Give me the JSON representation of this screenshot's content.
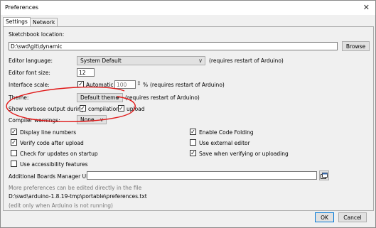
{
  "window": {
    "title": "Preferences",
    "close_glyph": "✕"
  },
  "tabs": [
    {
      "label": "Settings"
    },
    {
      "label": "Network"
    }
  ],
  "sketchbook": {
    "label": "Sketchbook location:",
    "value": "D:\\swd\\git\\dynamic",
    "browse_label": "Browse"
  },
  "editor_language": {
    "label": "Editor language:",
    "value": "System Default",
    "note": "(requires restart of Arduino)"
  },
  "editor_font": {
    "label": "Editor font size:",
    "value": "12"
  },
  "interface_scale": {
    "label": "Interface scale:",
    "automatic_label": "Automatic",
    "value": "100",
    "percent": "%",
    "note": "(requires restart of Arduino)"
  },
  "theme": {
    "label": "Theme:",
    "value": "Default theme",
    "note": "(requires restart of Arduino)"
  },
  "verbose": {
    "label": "Show verbose output during:",
    "compilation_label": "compilation",
    "upload_label": "upload"
  },
  "compiler_warnings": {
    "label": "Compiler warnings:",
    "value": "None"
  },
  "options_left": [
    {
      "label": "Display line numbers",
      "checked": true
    },
    {
      "label": "Verify code after upload",
      "checked": true
    },
    {
      "label": "Check for updates on startup",
      "checked": false
    },
    {
      "label": "Use accessibility features",
      "checked": false
    }
  ],
  "options_right": [
    {
      "label": "Enable Code Folding",
      "checked": true
    },
    {
      "label": "Use external editor",
      "checked": false
    },
    {
      "label": "Save when verifying or uploading",
      "checked": true
    }
  ],
  "boards_manager": {
    "label": "Additional Boards Manager URLs:",
    "value": ""
  },
  "more_prefs_hint": "More preferences can be edited directly in the file",
  "prefs_path": "D:\\swd\\arduino-1.8.19-tmp\\portable\\preferences.txt",
  "edit_hint": "(edit only when Arduino is not running)",
  "buttons": {
    "ok_label": "OK",
    "cancel_label": "Cancel"
  },
  "check_glyph": "✓",
  "spin_glyph": "⇕",
  "combo_arrow_glyph": "∨",
  "annotation_color": "#e01818",
  "icons": {
    "boards_manager_button": "window-stack-icon"
  }
}
